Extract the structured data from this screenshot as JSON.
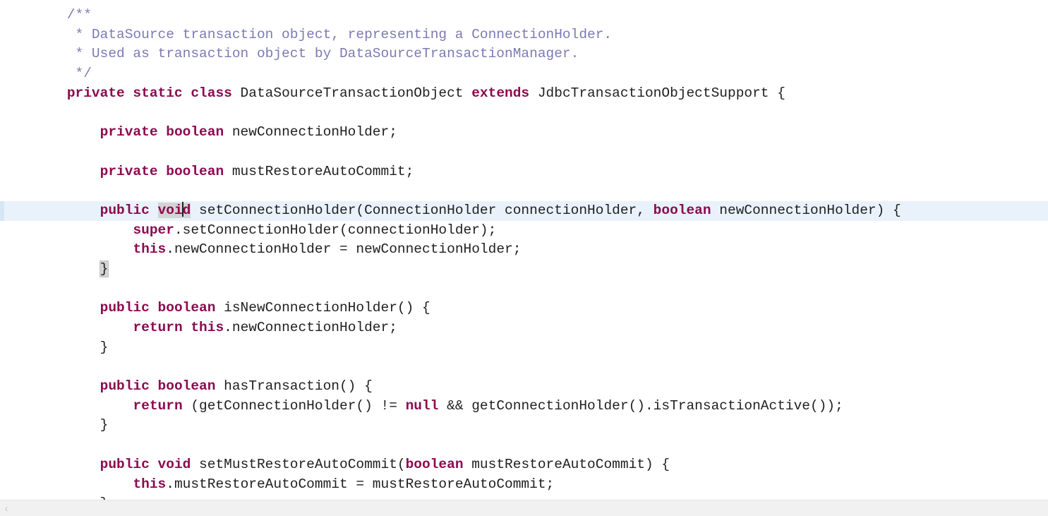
{
  "editor": {
    "language": "java",
    "theme": {
      "background": "#ffffff",
      "foreground": "#1f1f1f",
      "comment_color": "#7b7bb5",
      "keyword_color": "#8c0a50",
      "current_line_background": "#e9f2fb",
      "selection_background": "#d4d4d4",
      "scrollbar_background": "#f1f1f1"
    },
    "caret": {
      "line_index": 8,
      "after_text": "voi"
    },
    "lines": [
      {
        "index": 0,
        "current": false,
        "tokens": [
          {
            "kind": "comment",
            "text": "    /**"
          }
        ]
      },
      {
        "index": 1,
        "current": false,
        "tokens": [
          {
            "kind": "comment",
            "text": "     * DataSource transaction object, representing a ConnectionHolder."
          }
        ]
      },
      {
        "index": 2,
        "current": false,
        "tokens": [
          {
            "kind": "comment",
            "text": "     * Used as transaction object by DataSourceTransactionManager."
          }
        ]
      },
      {
        "index": 3,
        "current": false,
        "tokens": [
          {
            "kind": "comment",
            "text": "     */"
          }
        ]
      },
      {
        "index": 4,
        "current": false,
        "tokens": [
          {
            "kind": "plain",
            "text": "    "
          },
          {
            "kind": "keyword",
            "text": "private static class"
          },
          {
            "kind": "plain",
            "text": " DataSourceTransactionObject "
          },
          {
            "kind": "keyword",
            "text": "extends"
          },
          {
            "kind": "plain",
            "text": " JdbcTransactionObjectSupport {"
          }
        ]
      },
      {
        "index": 5,
        "current": false,
        "tokens": [
          {
            "kind": "plain",
            "text": ""
          }
        ]
      },
      {
        "index": 6,
        "current": false,
        "tokens": [
          {
            "kind": "plain",
            "text": "        "
          },
          {
            "kind": "keyword",
            "text": "private boolean"
          },
          {
            "kind": "plain",
            "text": " newConnectionHolder;"
          }
        ]
      },
      {
        "index": 7,
        "current": false,
        "tokens": [
          {
            "kind": "plain",
            "text": ""
          }
        ]
      },
      {
        "index": 8,
        "current": false,
        "tokens": [
          {
            "kind": "plain",
            "text": "        "
          },
          {
            "kind": "keyword",
            "text": "private boolean"
          },
          {
            "kind": "plain",
            "text": " mustRestoreAutoCommit;"
          }
        ]
      },
      {
        "index": 9,
        "current": false,
        "tokens": [
          {
            "kind": "plain",
            "text": ""
          }
        ]
      },
      {
        "index": 10,
        "current": true,
        "tokens": [
          {
            "kind": "plain",
            "text": "        "
          },
          {
            "kind": "keyword",
            "text": "public"
          },
          {
            "kind": "plain",
            "text": " "
          },
          {
            "kind": "keyword-selected",
            "text": "void",
            "caret_after": "voi"
          },
          {
            "kind": "plain",
            "text": " setConnectionHolder(ConnectionHolder connectionHolder, "
          },
          {
            "kind": "keyword",
            "text": "boolean"
          },
          {
            "kind": "plain",
            "text": " newConnectionHolder) {"
          }
        ]
      },
      {
        "index": 11,
        "current": false,
        "tokens": [
          {
            "kind": "plain",
            "text": "            "
          },
          {
            "kind": "keyword",
            "text": "super"
          },
          {
            "kind": "plain",
            "text": ".setConnectionHolder(connectionHolder);"
          }
        ]
      },
      {
        "index": 12,
        "current": false,
        "tokens": [
          {
            "kind": "plain",
            "text": "            "
          },
          {
            "kind": "keyword",
            "text": "this"
          },
          {
            "kind": "plain",
            "text": ".newConnectionHolder = newConnectionHolder;"
          }
        ]
      },
      {
        "index": 13,
        "current": false,
        "tokens": [
          {
            "kind": "plain",
            "text": "        "
          },
          {
            "kind": "brace-match",
            "text": "}"
          }
        ]
      },
      {
        "index": 14,
        "current": false,
        "tokens": [
          {
            "kind": "plain",
            "text": ""
          }
        ]
      },
      {
        "index": 15,
        "current": false,
        "tokens": [
          {
            "kind": "plain",
            "text": "        "
          },
          {
            "kind": "keyword",
            "text": "public boolean"
          },
          {
            "kind": "plain",
            "text": " isNewConnectionHolder() {"
          }
        ]
      },
      {
        "index": 16,
        "current": false,
        "tokens": [
          {
            "kind": "plain",
            "text": "            "
          },
          {
            "kind": "keyword",
            "text": "return this"
          },
          {
            "kind": "plain",
            "text": ".newConnectionHolder;"
          }
        ]
      },
      {
        "index": 17,
        "current": false,
        "tokens": [
          {
            "kind": "plain",
            "text": "        }"
          }
        ]
      },
      {
        "index": 18,
        "current": false,
        "tokens": [
          {
            "kind": "plain",
            "text": ""
          }
        ]
      },
      {
        "index": 19,
        "current": false,
        "tokens": [
          {
            "kind": "plain",
            "text": "        "
          },
          {
            "kind": "keyword",
            "text": "public boolean"
          },
          {
            "kind": "plain",
            "text": " hasTransaction() {"
          }
        ]
      },
      {
        "index": 20,
        "current": false,
        "tokens": [
          {
            "kind": "plain",
            "text": "            "
          },
          {
            "kind": "keyword",
            "text": "return"
          },
          {
            "kind": "plain",
            "text": " (getConnectionHolder() != "
          },
          {
            "kind": "keyword",
            "text": "null"
          },
          {
            "kind": "plain",
            "text": " && getConnectionHolder().isTransactionActive());"
          }
        ]
      },
      {
        "index": 21,
        "current": false,
        "tokens": [
          {
            "kind": "plain",
            "text": "        }"
          }
        ]
      },
      {
        "index": 22,
        "current": false,
        "tokens": [
          {
            "kind": "plain",
            "text": ""
          }
        ]
      },
      {
        "index": 23,
        "current": false,
        "tokens": [
          {
            "kind": "plain",
            "text": "        "
          },
          {
            "kind": "keyword",
            "text": "public void"
          },
          {
            "kind": "plain",
            "text": " setMustRestoreAutoCommit("
          },
          {
            "kind": "keyword",
            "text": "boolean"
          },
          {
            "kind": "plain",
            "text": " mustRestoreAutoCommit) {"
          }
        ]
      },
      {
        "index": 24,
        "current": false,
        "tokens": [
          {
            "kind": "plain",
            "text": "            "
          },
          {
            "kind": "keyword",
            "text": "this"
          },
          {
            "kind": "plain",
            "text": ".mustRestoreAutoCommit = mustRestoreAutoCommit;"
          }
        ]
      },
      {
        "index": 25,
        "current": false,
        "tokens": [
          {
            "kind": "plain",
            "text": "        }"
          }
        ]
      }
    ]
  },
  "scrollbar": {
    "left_arrow_glyph": "‹",
    "orientation": "horizontal"
  }
}
